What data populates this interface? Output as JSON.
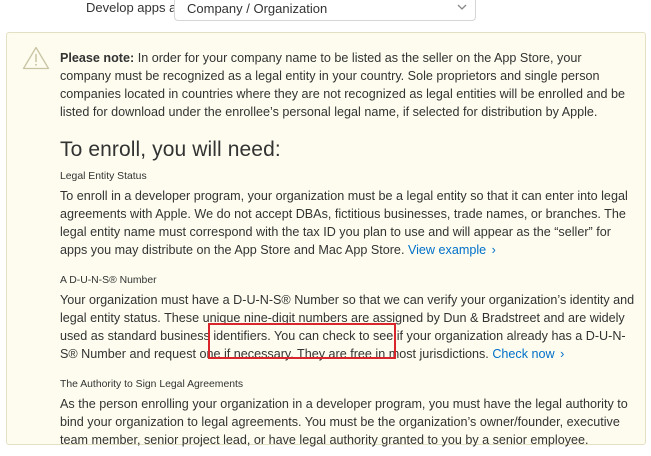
{
  "top_row": {
    "label": "Develop apps as",
    "select_value": "Company / Organization"
  },
  "note": {
    "bold_lead": "Please note:",
    "text": " In order for your company name to be listed as the seller on the App Store, your company must be recognized as a legal entity in your country. Sole proprietors and single person companies located in countries where they are not recognized as legal entities will be enrolled and be listed for download under the enrollee’s personal legal name, if selected for distribution by Apple."
  },
  "heading": "To enroll, you will need:",
  "sections": {
    "legal_entity": {
      "title": "Legal Entity Status",
      "text": "To enroll in a developer program, your organization must be a legal entity so that it can enter into legal agreements with Apple. We do not accept DBAs, fictitious businesses, trade names, or branches. The legal entity name must correspond with the tax ID you plan to use and will appear as the “seller” for apps you may distribute on the App Store and Mac App Store. ",
      "link_label": "View example",
      "link_chevron": "›"
    },
    "duns": {
      "title": "A D-U-N-S® Number",
      "text": "Your organization must have a D-U-N-S® Number so that we can verify your organization’s identity and legal entity status. These unique nine-digit numbers are assigned by Dun & Bradstreet and are widely used as standard business identifiers. You can check to see if your organization already has a D-U-N-S® Number and request one if necessary. They are free in most jurisdictions. ",
      "link_label": "Check now",
      "link_chevron": "›"
    },
    "authority": {
      "title": "The Authority to Sign Legal Agreements",
      "text": "As the person enrolling your organization in a developer program, you must have the legal authority to bind your organization to legal agreements. You must be the organization’s owner/founder, executive team member, senior project lead, or have legal authority granted to you by a senior employee."
    }
  },
  "colors": {
    "note_background": "#fdfcef",
    "link": "#0070c9",
    "annotation": "#d8262c"
  },
  "icons": {
    "warning": "warning-triangle-icon",
    "select_chevron": "chevron-down-icon"
  }
}
